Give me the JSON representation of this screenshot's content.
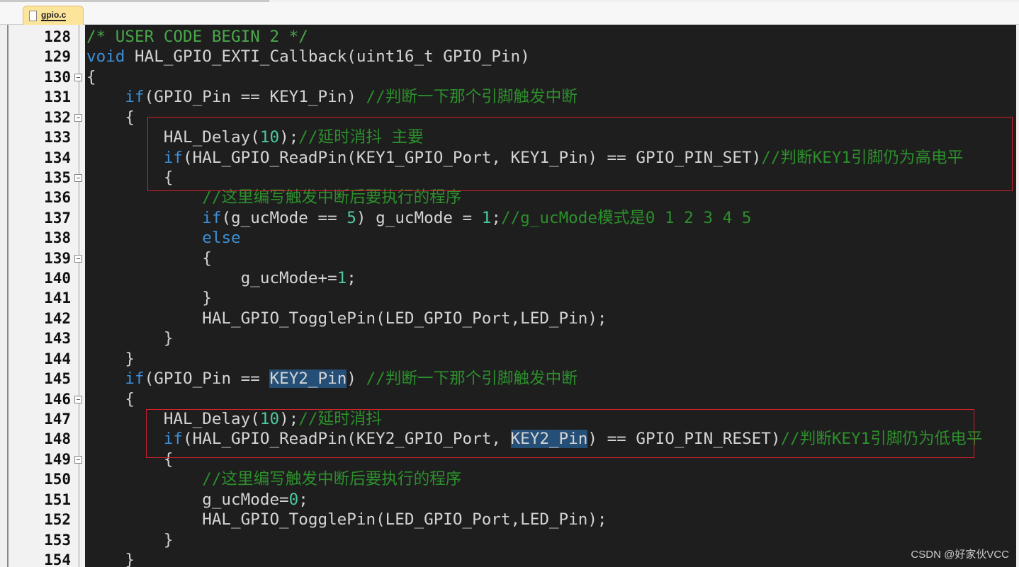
{
  "tab": {
    "filename": "gpio.c",
    "icon": "file-icon"
  },
  "watermark": "CSDN @好家伙VCC",
  "colors": {
    "background": "#1e1e1e",
    "keyword": "#3c8fd8",
    "comment": "#2c8f2c",
    "number": "#4ec9a0",
    "highlight": "#264f78",
    "annotation_box": "#d0202a"
  },
  "fold_lines": [
    130,
    132,
    135,
    139,
    146,
    149
  ],
  "lines": [
    {
      "n": "128",
      "tokens": [
        [
          "/* USER CODE BEGIN 2 */",
          "cmh"
        ]
      ]
    },
    {
      "n": "129",
      "tokens": [
        [
          "void",
          "kw"
        ],
        [
          " HAL_GPIO_EXTI_Callback(uint16_t GPIO_Pin)",
          ""
        ]
      ]
    },
    {
      "n": "130",
      "tokens": [
        [
          "{",
          ""
        ]
      ]
    },
    {
      "n": "131",
      "tokens": [
        [
          "    ",
          ""
        ],
        [
          "if",
          "kw"
        ],
        [
          "(GPIO_Pin == KEY1_Pin) ",
          ""
        ],
        [
          "//判断一下那个引脚触发中断",
          "cm"
        ]
      ]
    },
    {
      "n": "132",
      "tokens": [
        [
          "    {",
          ""
        ]
      ]
    },
    {
      "n": "133",
      "tokens": [
        [
          "        HAL_Delay(",
          ""
        ],
        [
          "10",
          "nm"
        ],
        [
          ");",
          ""
        ],
        [
          "//延时消抖 主要",
          "cm"
        ]
      ]
    },
    {
      "n": "134",
      "tokens": [
        [
          "        ",
          ""
        ],
        [
          "if",
          "kw"
        ],
        [
          "(HAL_GPIO_ReadPin(KEY1_GPIO_Port, KEY1_Pin) == GPIO_PIN_SET)",
          ""
        ],
        [
          "//判断KEY1引脚仍为高电平",
          "cm"
        ]
      ]
    },
    {
      "n": "135",
      "tokens": [
        [
          "        {",
          ""
        ]
      ]
    },
    {
      "n": "136",
      "tokens": [
        [
          "            ",
          ""
        ],
        [
          "//这里编写触发中断后要执行的程序",
          "cm"
        ]
      ]
    },
    {
      "n": "137",
      "tokens": [
        [
          "            ",
          ""
        ],
        [
          "if",
          "kw"
        ],
        [
          "(g_ucMode == ",
          ""
        ],
        [
          "5",
          "nm"
        ],
        [
          ") g_ucMode = ",
          ""
        ],
        [
          "1",
          "nm"
        ],
        [
          ";",
          ""
        ],
        [
          "//g_ucMode模式是0 1 2 3 4 5",
          "cm"
        ]
      ]
    },
    {
      "n": "138",
      "tokens": [
        [
          "            ",
          ""
        ],
        [
          "else",
          "kw"
        ]
      ]
    },
    {
      "n": "139",
      "tokens": [
        [
          "            {",
          ""
        ]
      ]
    },
    {
      "n": "140",
      "tokens": [
        [
          "                g_ucMode+=",
          ""
        ],
        [
          "1",
          "nm"
        ],
        [
          ";",
          ""
        ]
      ]
    },
    {
      "n": "141",
      "tokens": [
        [
          "            }",
          ""
        ]
      ]
    },
    {
      "n": "142",
      "tokens": [
        [
          "            HAL_GPIO_TogglePin(LED_GPIO_Port,LED_Pin);",
          ""
        ]
      ]
    },
    {
      "n": "143",
      "tokens": [
        [
          "        }",
          ""
        ]
      ]
    },
    {
      "n": "144",
      "tokens": [
        [
          "    }",
          ""
        ]
      ]
    },
    {
      "n": "145",
      "tokens": [
        [
          "    ",
          ""
        ],
        [
          "if",
          "kw"
        ],
        [
          "(GPIO_Pin == ",
          ""
        ],
        [
          "KEY2_Pin",
          "hl"
        ],
        [
          ") ",
          ""
        ],
        [
          "//判断一下那个引脚触发中断",
          "cm"
        ]
      ]
    },
    {
      "n": "146",
      "tokens": [
        [
          "    {",
          ""
        ]
      ]
    },
    {
      "n": "147",
      "tokens": [
        [
          "        HAL_Delay(",
          ""
        ],
        [
          "10",
          "nm"
        ],
        [
          ");",
          ""
        ],
        [
          "//延时消抖",
          "cm"
        ]
      ]
    },
    {
      "n": "148",
      "tokens": [
        [
          "        ",
          ""
        ],
        [
          "if",
          "kw"
        ],
        [
          "(HAL_GPIO_ReadPin(KEY2_GPIO_Port, ",
          ""
        ],
        [
          "KEY2_Pin",
          "hl"
        ],
        [
          ") == GPIO_PIN_RESET)",
          ""
        ],
        [
          "//判断KEY1引脚仍为低电平",
          "cm"
        ]
      ]
    },
    {
      "n": "149",
      "tokens": [
        [
          "        {",
          ""
        ]
      ]
    },
    {
      "n": "150",
      "tokens": [
        [
          "            ",
          ""
        ],
        [
          "//这里编写触发中断后要执行的程序",
          "cm"
        ]
      ]
    },
    {
      "n": "151",
      "tokens": [
        [
          "            g_ucMode=",
          ""
        ],
        [
          "0",
          "nm"
        ],
        [
          ";",
          ""
        ]
      ]
    },
    {
      "n": "152",
      "tokens": [
        [
          "            HAL_GPIO_TogglePin(LED_GPIO_Port,LED_Pin);",
          ""
        ]
      ]
    },
    {
      "n": "153",
      "tokens": [
        [
          "        }",
          ""
        ]
      ]
    },
    {
      "n": "154",
      "tokens": [
        [
          "    }",
          ""
        ]
      ]
    }
  ]
}
